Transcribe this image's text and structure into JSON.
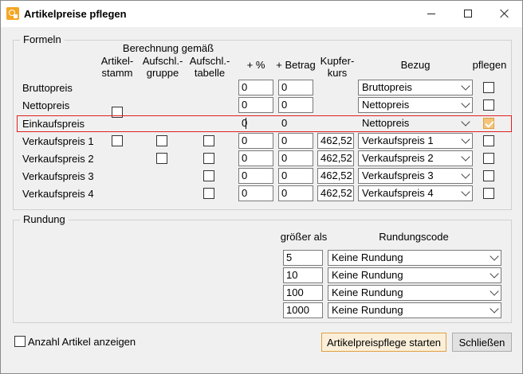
{
  "window": {
    "title": "Artikelpreise pflegen"
  },
  "formeln": {
    "legend": "Formeln",
    "headers": {
      "berechnung": "Berechnung gemäß",
      "artikelstamm": [
        "Artikel-",
        "stamm"
      ],
      "aufschl_gruppe": [
        "Aufschl.-",
        "gruppe"
      ],
      "aufschl_tabelle": [
        "Aufschl.-",
        "tabelle"
      ],
      "prozent": "+ %",
      "betrag": "+ Betrag",
      "kupferkurs": [
        "Kupfer-",
        "kurs"
      ],
      "bezug": "Bezug",
      "pflegen": "pflegen"
    },
    "rows": [
      {
        "label": "Bruttopreis",
        "prozent": "0",
        "betrag": "0",
        "kupfer": "",
        "bezug": "Bruttopreis",
        "pflegen": false
      },
      {
        "label": "Nettopreis",
        "prozent": "0",
        "betrag": "0",
        "kupfer": "",
        "bezug": "Nettopreis",
        "pflegen": false
      },
      {
        "label": "Einkaufspreis",
        "prozent": "0",
        "betrag": "0",
        "kupfer": "",
        "bezug": "Nettopreis",
        "pflegen": true
      },
      {
        "label": "Verkaufspreis 1",
        "prozent": "0",
        "betrag": "0",
        "kupfer": "462,52",
        "bezug": "Verkaufspreis 1",
        "pflegen": false
      },
      {
        "label": "Verkaufspreis 2",
        "prozent": "0",
        "betrag": "0",
        "kupfer": "462,52",
        "bezug": "Verkaufspreis 2",
        "pflegen": false
      },
      {
        "label": "Verkaufspreis 3",
        "prozent": "0",
        "betrag": "0",
        "kupfer": "462,52",
        "bezug": "Verkaufspreis 3",
        "pflegen": false
      },
      {
        "label": "Verkaufspreis 4",
        "prozent": "0",
        "betrag": "0",
        "kupfer": "462,52",
        "bezug": "Verkaufspreis 4",
        "pflegen": false
      }
    ]
  },
  "rundung": {
    "legend": "Rundung",
    "header_groesser": "größer als",
    "header_code": "Rundungscode",
    "rows": [
      {
        "value": "5",
        "code": "Keine Rundung"
      },
      {
        "value": "10",
        "code": "Keine Rundung"
      },
      {
        "value": "100",
        "code": "Keine Rundung"
      },
      {
        "value": "1000",
        "code": "Keine Rundung"
      }
    ]
  },
  "footer": {
    "anzahl_label": "Anzahl Artikel anzeigen",
    "start_button": "Artikelpreispflege starten",
    "close_button": "Schließen"
  },
  "colors": {
    "highlight": "#e02020",
    "accent": "#f3c47a"
  }
}
